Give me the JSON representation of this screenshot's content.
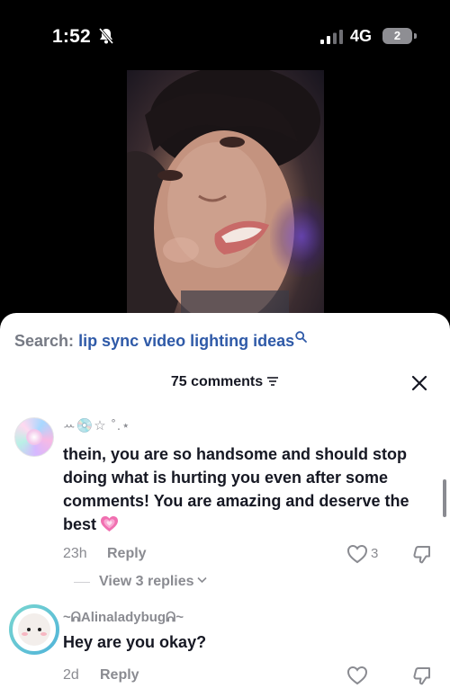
{
  "status_bar": {
    "time": "1:52",
    "network": "4G",
    "battery": "2",
    "icons": [
      "bell-slash-icon",
      "signal-bars-icon",
      "battery-icon"
    ]
  },
  "search": {
    "label": "Search:",
    "query": "lip sync video lighting ideas"
  },
  "comments_header": {
    "count_label": "75 comments"
  },
  "comments": [
    {
      "username": "ꕀ💿☆ ˚.⋆",
      "text": "thein, you are so handsome and should stop doing what is hurting you even after some comments! You are amazing and deserve the best",
      "emoji": "growing-heart",
      "time": "23h",
      "reply_label": "Reply",
      "likes": "3",
      "view_replies": "View 3 replies"
    },
    {
      "username": "~ᕱAlinaladybugᕱ~",
      "text": "Hey are you okay?",
      "time": "2d",
      "reply_label": "Reply"
    }
  ],
  "colors": {
    "search_query": "#2f5aa8",
    "muted": "#8a8b91",
    "text": "#161823",
    "heart_emoji": "#f06fb0"
  }
}
